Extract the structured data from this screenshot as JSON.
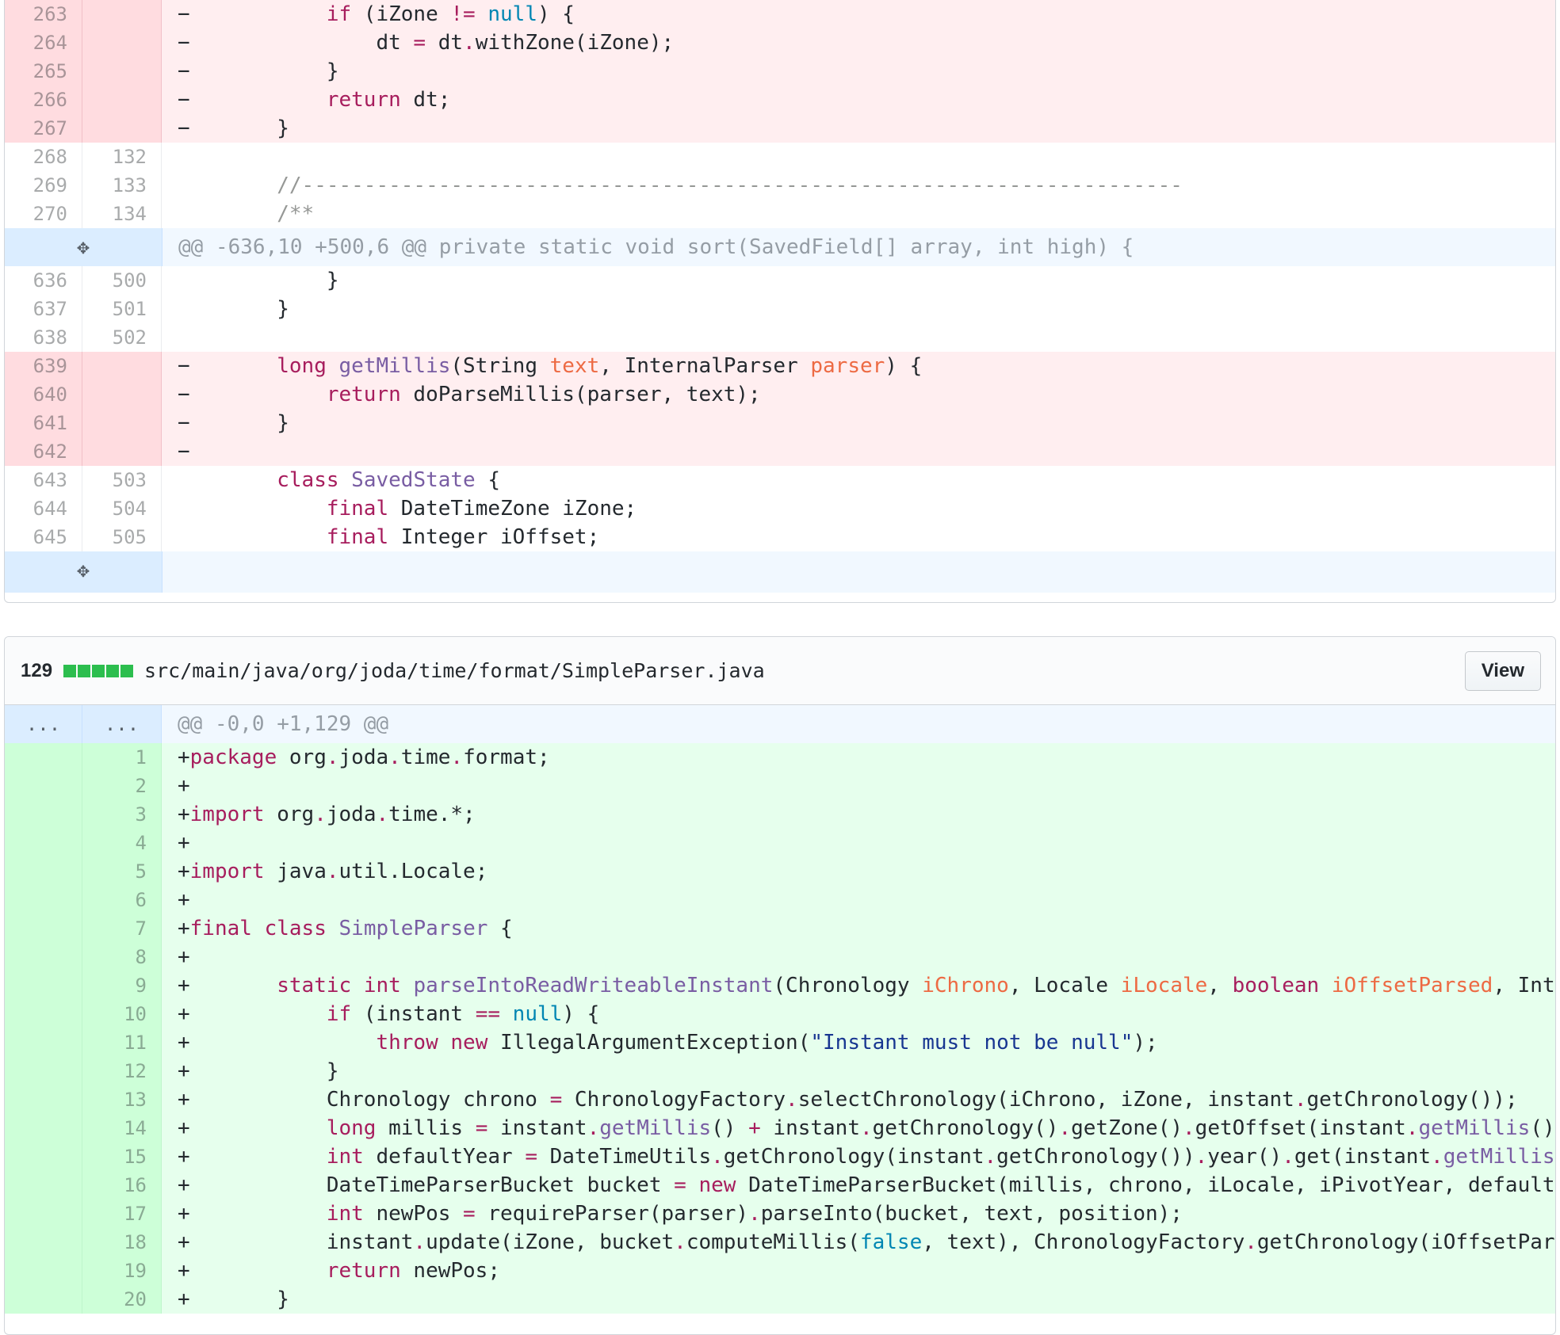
{
  "diff1": {
    "rows": [
      {
        "type": "del",
        "old": "263",
        "new": "",
        "sign": "−",
        "code": "        if (iZone != null) {"
      },
      {
        "type": "del",
        "old": "264",
        "new": "",
        "sign": "−",
        "code": "            dt = dt.withZone(iZone);"
      },
      {
        "type": "del",
        "old": "265",
        "new": "",
        "sign": "−",
        "code": "        }"
      },
      {
        "type": "del",
        "old": "266",
        "new": "",
        "sign": "−",
        "code": "        return dt;"
      },
      {
        "type": "del",
        "old": "267",
        "new": "",
        "sign": "−",
        "code": "    }"
      },
      {
        "type": "ctx",
        "old": "268",
        "new": "132",
        "sign": " ",
        "code": ""
      },
      {
        "type": "ctx",
        "old": "269",
        "new": "133",
        "sign": " ",
        "code": "    //-----------------------------------------------------------------------"
      },
      {
        "type": "ctx",
        "old": "270",
        "new": "134",
        "sign": " ",
        "code": "    /**"
      },
      {
        "type": "hunk",
        "text": "@@ -636,10 +500,6 @@ private static void sort(SavedField[] array, int high) {"
      },
      {
        "type": "ctx",
        "old": "636",
        "new": "500",
        "sign": " ",
        "code": "        }"
      },
      {
        "type": "ctx",
        "old": "637",
        "new": "501",
        "sign": " ",
        "code": "    }"
      },
      {
        "type": "ctx",
        "old": "638",
        "new": "502",
        "sign": " ",
        "code": ""
      },
      {
        "type": "del",
        "old": "639",
        "new": "",
        "sign": "−",
        "code": "    long getMillis(String text, InternalParser parser) {"
      },
      {
        "type": "del",
        "old": "640",
        "new": "",
        "sign": "−",
        "code": "        return doParseMillis(parser, text);"
      },
      {
        "type": "del",
        "old": "641",
        "new": "",
        "sign": "−",
        "code": "    }"
      },
      {
        "type": "del",
        "old": "642",
        "new": "",
        "sign": "−",
        "code": ""
      },
      {
        "type": "ctx",
        "old": "643",
        "new": "503",
        "sign": " ",
        "code": "    class SavedState {"
      },
      {
        "type": "ctx",
        "old": "644",
        "new": "504",
        "sign": " ",
        "code": "        final DateTimeZone iZone;"
      },
      {
        "type": "ctx",
        "old": "645",
        "new": "505",
        "sign": " ",
        "code": "        final Integer iOffset;"
      }
    ]
  },
  "file2": {
    "additions": "129",
    "path": "src/main/java/org/joda/time/format/SimpleParser.java",
    "view_label": "View",
    "ellipsis": "...",
    "hunk": "@@ -0,0 +1,129 @@",
    "rows": [
      {
        "n": "1",
        "code": "+package org.joda.time.format;"
      },
      {
        "n": "2",
        "code": "+"
      },
      {
        "n": "3",
        "code": "+import org.joda.time.*;"
      },
      {
        "n": "4",
        "code": "+"
      },
      {
        "n": "5",
        "code": "+import java.util.Locale;"
      },
      {
        "n": "6",
        "code": "+"
      },
      {
        "n": "7",
        "code": "+final class SimpleParser {"
      },
      {
        "n": "8",
        "code": "+"
      },
      {
        "n": "9",
        "code": "+    static int parseIntoReadWriteableInstant(Chronology iChrono, Locale iLocale, boolean iOffsetParsed, Integer iPivotYe"
      },
      {
        "n": "10",
        "code": "+        if (instant == null) {"
      },
      {
        "n": "11",
        "code": "+            throw new IllegalArgumentException(\"Instant must not be null\");"
      },
      {
        "n": "12",
        "code": "+        }"
      },
      {
        "n": "13",
        "code": "+        Chronology chrono = ChronologyFactory.selectChronology(iChrono, iZone, instant.getChronology());"
      },
      {
        "n": "14",
        "code": "+        long millis = instant.getMillis() + instant.getChronology().getZone().getOffset(instant.getMillis());"
      },
      {
        "n": "15",
        "code": "+        int defaultYear = DateTimeUtils.getChronology(instant.getChronology()).year().get(instant.getMillis());"
      },
      {
        "n": "16",
        "code": "+        DateTimeParserBucket bucket = new DateTimeParserBucket(millis, chrono, iLocale, iPivotYear, defaultYear);"
      },
      {
        "n": "17",
        "code": "+        int newPos = requireParser(parser).parseInto(bucket, text, position);"
      },
      {
        "n": "18",
        "code": "+        instant.update(iZone, bucket.computeMillis(false, text), ChronologyFactory.getChronology(iOffsetParsed, bucket.g"
      },
      {
        "n": "19",
        "code": "+        return newPos;"
      },
      {
        "n": "20",
        "code": "+    }"
      }
    ]
  },
  "colors": {
    "deleted": "#ffeef0",
    "added": "#e6ffed",
    "hunk": "#f1f8ff",
    "diffstat": "#2cbe4e"
  },
  "icons": {
    "expand": "unfold-icon"
  }
}
